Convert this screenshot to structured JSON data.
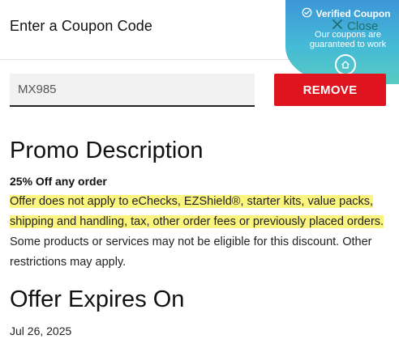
{
  "header": {
    "title": "Enter a Coupon Code",
    "close_label": "Close"
  },
  "badge": {
    "title": "Verified Coupon",
    "subtitle": "Our coupons are guaranteed to work"
  },
  "coupon": {
    "value": "MX985",
    "remove_label": "REMOVE"
  },
  "promo": {
    "heading": "Promo Description",
    "amount": "25% Off any order",
    "highlighted_text": "Offer does not apply to eChecks, EZShield®, starter kits, value packs, shipping and handling, tax, other order fees or previously placed orders.",
    "rest_text": " Some products or services may not be eligible for this discount. Other restrictions may apply."
  },
  "expires": {
    "heading": "Offer Expires On",
    "date": "Jul 26, 2025"
  },
  "colors": {
    "accent_red": "#e0141e",
    "highlight": "#fbf47f",
    "badge_blue": "#2f8fd6",
    "badge_teal": "#4cc7bf",
    "close_text": "#1f6f6f"
  }
}
